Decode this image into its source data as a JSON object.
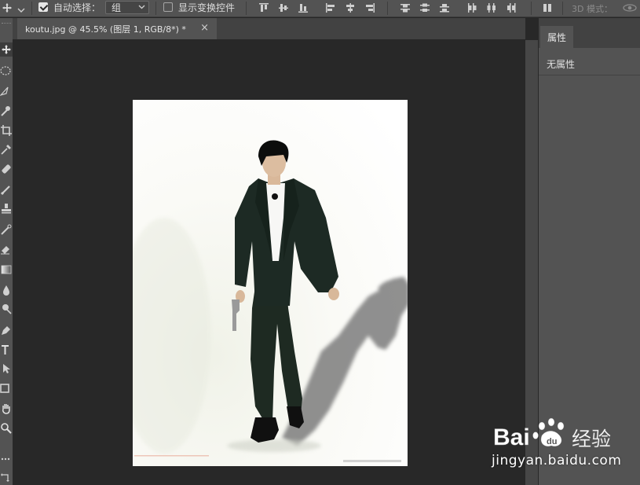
{
  "options_bar": {
    "auto_select_label": "自动选择：",
    "auto_select_checked": true,
    "auto_select_target": "组",
    "show_transform_label": "显示变换控件",
    "show_transform_checked": false,
    "mode_3d_label": "3D 模式："
  },
  "document_tab": {
    "title": "koutu.jpg @ 45.5% (图层 1, RGB/8*) *",
    "close_glyph": "×"
  },
  "properties_panel": {
    "tab_label": "属性",
    "empty_text": "无属性"
  },
  "watermark": {
    "brand": "Bai 经验",
    "url": "jingyan.baidu.com"
  },
  "toolbar": {
    "tools": [
      "move-tool",
      "lasso-tool",
      "polygon-lasso-tool",
      "quick-select-tool",
      "crop-tool",
      "eyedropper-tool",
      "healing-brush-tool",
      "brush-tool",
      "clone-stamp-tool",
      "history-brush-tool",
      "eraser-tool",
      "gradient-tool",
      "blur-tool",
      "dodge-tool",
      "pen-tool",
      "type-tool",
      "path-select-tool",
      "rectangle-tool",
      "hand-tool",
      "zoom-tool",
      "more-tools",
      "swap-colors"
    ]
  },
  "colors": {
    "panel_bg": "#535353",
    "canvas_bg": "#282828",
    "tab_bar_bg": "#424242"
  }
}
